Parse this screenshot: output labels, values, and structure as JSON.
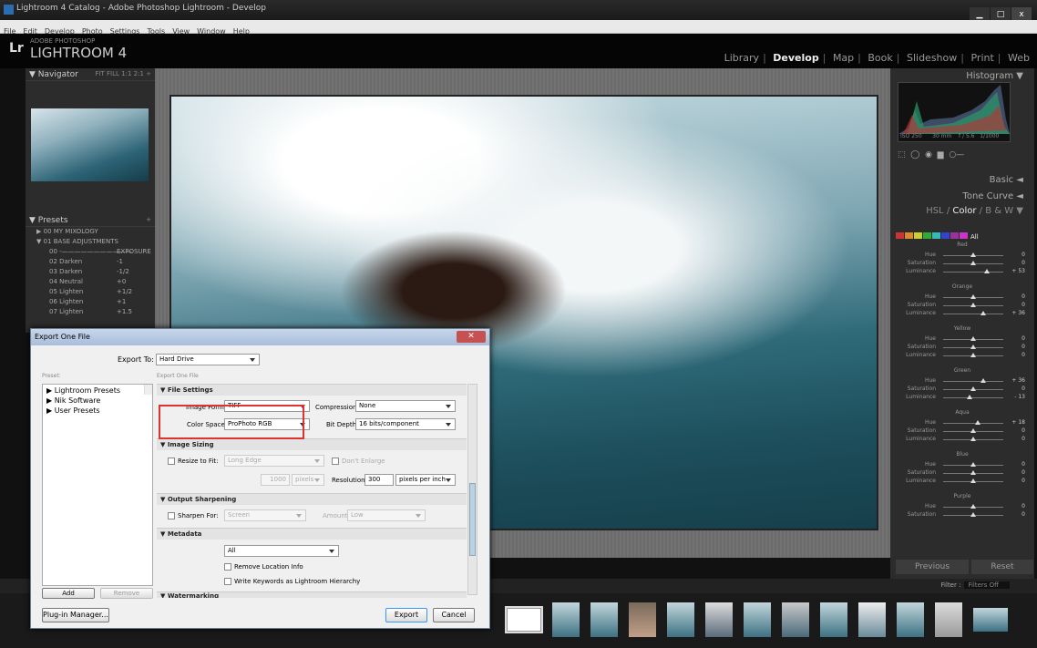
{
  "window": {
    "title": "Lightroom 4 Catalog - Adobe Photoshop Lightroom - Develop",
    "buttons": [
      "▁",
      "□",
      "x"
    ]
  },
  "menu": [
    "File",
    "Edit",
    "Develop",
    "Photo",
    "Settings",
    "Tools",
    "View",
    "Window",
    "Help"
  ],
  "header": {
    "logo": "Lr",
    "subtitle": "ADOBE PHOTOSHOP",
    "product": "LIGHTROOM 4"
  },
  "modules": [
    {
      "label": "Library",
      "active": false
    },
    {
      "label": "Develop",
      "active": true
    },
    {
      "label": "Map",
      "active": false
    },
    {
      "label": "Book",
      "active": false
    },
    {
      "label": "Slideshow",
      "active": false
    },
    {
      "label": "Print",
      "active": false
    },
    {
      "label": "Web",
      "active": false
    }
  ],
  "navigator": {
    "title": "Navigator",
    "zoom": "FIT  FILL  1:1  2:1 ÷"
  },
  "presets": {
    "title": "Presets",
    "groups": [
      "00 MY MIXOLOGY",
      "01 BASE ADJUSTMENTS"
    ],
    "items": [
      {
        "name": "00 -———————————",
        "value": "EXPOSURE"
      },
      {
        "name": "02 Darken",
        "value": "-1"
      },
      {
        "name": "03 Darken",
        "value": "-1/2"
      },
      {
        "name": "04 Neutral",
        "value": "+0"
      },
      {
        "name": "05 Lighten",
        "value": "+1/2"
      },
      {
        "name": "06 Lighten",
        "value": "+1"
      },
      {
        "name": "07 Lighten",
        "value": "+1.5"
      }
    ]
  },
  "histogram": {
    "title": "Histogram ▼",
    "info": [
      "ISO 250",
      "30 mm",
      "f / 5.6",
      "1/1000"
    ]
  },
  "right_sections": {
    "basic": "Basic ◄",
    "tone_curve": "Tone Curve ◄",
    "hsl": "HSL",
    "color": "Color",
    "bw": "B & W",
    "all": "All"
  },
  "color_groups": [
    {
      "name": "Red",
      "rows": [
        {
          "label": "Hue",
          "value": "0",
          "pos": 0.5
        },
        {
          "label": "Saturation",
          "value": "0",
          "pos": 0.5
        },
        {
          "label": "Luminance",
          "value": "+ 53",
          "pos": 0.72
        }
      ]
    },
    {
      "name": "Orange",
      "rows": [
        {
          "label": "Hue",
          "value": "0",
          "pos": 0.5
        },
        {
          "label": "Saturation",
          "value": "0",
          "pos": 0.5
        },
        {
          "label": "Luminance",
          "value": "+ 36",
          "pos": 0.66
        }
      ]
    },
    {
      "name": "Yellow",
      "rows": [
        {
          "label": "Hue",
          "value": "0",
          "pos": 0.5
        },
        {
          "label": "Saturation",
          "value": "0",
          "pos": 0.5
        },
        {
          "label": "Luminance",
          "value": "0",
          "pos": 0.5
        }
      ]
    },
    {
      "name": "Green",
      "rows": [
        {
          "label": "Hue",
          "value": "+ 36",
          "pos": 0.66
        },
        {
          "label": "Saturation",
          "value": "0",
          "pos": 0.5
        },
        {
          "label": "Luminance",
          "value": "- 13",
          "pos": 0.44
        }
      ]
    },
    {
      "name": "Aqua",
      "rows": [
        {
          "label": "Hue",
          "value": "+ 18",
          "pos": 0.58
        },
        {
          "label": "Saturation",
          "value": "0",
          "pos": 0.5
        },
        {
          "label": "Luminance",
          "value": "0",
          "pos": 0.5
        }
      ]
    },
    {
      "name": "Blue",
      "rows": [
        {
          "label": "Hue",
          "value": "0",
          "pos": 0.5
        },
        {
          "label": "Saturation",
          "value": "0",
          "pos": 0.5
        },
        {
          "label": "Luminance",
          "value": "0",
          "pos": 0.5
        }
      ]
    },
    {
      "name": "Purple",
      "rows": [
        {
          "label": "Hue",
          "value": "0",
          "pos": 0.5
        },
        {
          "label": "Saturation",
          "value": "0",
          "pos": 0.5
        }
      ]
    }
  ],
  "bottom_buttons": {
    "previous": "Previous",
    "reset": "Reset"
  },
  "filter": {
    "label": "Filter :",
    "value": "Filters Off"
  },
  "dialog": {
    "title": "Export One File",
    "export_to_label": "Export To:",
    "export_to_value": "Hard Drive",
    "presets_label": "Preset:",
    "export_one_file": "Export One File",
    "preset_items": [
      "▶ Lightroom Presets",
      "▶ Nik Software",
      "▶ User Presets"
    ],
    "sections": {
      "file_settings": "▼ File Settings",
      "image_sizing": "▼ Image Sizing",
      "output_sharpening": "▼ Output Sharpening",
      "metadata": "▼ Metadata",
      "watermarking": "▼ Watermarking"
    },
    "image_format_label": "Image Format:",
    "image_format_value": "TIFF",
    "compression_label": "Compression:",
    "compression_value": "None",
    "color_space_label": "Color Space:",
    "color_space_value": "ProPhoto RGB",
    "bit_depth_label": "Bit Depth:",
    "bit_depth_value": "16 bits/component",
    "resize_label": "Resize to Fit:",
    "resize_value": "Long Edge",
    "dont_enlarge": "Don't Enlarge",
    "size_value": "1000",
    "size_unit": "pixels",
    "resolution_label": "Resolution:",
    "resolution_value": "300",
    "resolution_unit": "pixels per inch",
    "sharpen_label": "Sharpen For:",
    "sharpen_value": "Screen",
    "amount_label": "Amount:",
    "amount_value": "Low",
    "metadata_value": "All",
    "remove_location": "Remove Location Info",
    "write_keywords": "Write Keywords as Lightroom Hierarchy",
    "add": "Add",
    "remove": "Remove",
    "plugin_manager": "Plug-in Manager...",
    "export": "Export",
    "cancel": "Cancel"
  }
}
